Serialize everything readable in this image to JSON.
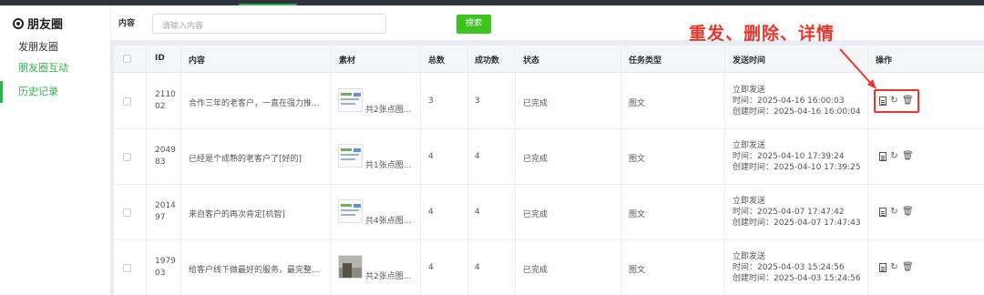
{
  "sidebar": {
    "title": "朋友圈",
    "items": [
      {
        "label": "发朋友圈"
      },
      {
        "label": "朋友圈互动"
      },
      {
        "label": "历史记录"
      }
    ]
  },
  "filter": {
    "label": "内容",
    "placeholder": "请输入内容",
    "search_label": "搜索"
  },
  "annotation": "重发、删除、详情",
  "table": {
    "headers": [
      "ID",
      "内容",
      "素材",
      "总数",
      "成功数",
      "状态",
      "任务类型",
      "发送时间",
      "操作"
    ],
    "rows": [
      {
        "id_a": "2110",
        "id_b": "02",
        "content": "合作三年的老客户，一直在强力推...",
        "material": "共2张点图...",
        "total": "3",
        "success": "3",
        "status": "已完成",
        "type": "图文",
        "send": "立即发送",
        "time": "时间：2025-04-16 16:00:03",
        "created": "创建时间：2025-04-16 16:00:04"
      },
      {
        "id_a": "2049",
        "id_b": "83",
        "content": "已经是个成熟的老客户了[好的]",
        "material": "共1张点图...",
        "total": "4",
        "success": "4",
        "status": "已完成",
        "type": "图文",
        "send": "立即发送",
        "time": "时间：2025-04-10 17:39:24",
        "created": "创建时间：2025-04-10 17:39:25"
      },
      {
        "id_a": "2014",
        "id_b": "97",
        "content": "来自客户的再次肯定[机智]",
        "material": "共4张点图...",
        "total": "4",
        "success": "4",
        "status": "已完成",
        "type": "图文",
        "send": "立即发送",
        "time": "时间：2025-04-07 17:47:42",
        "created": "创建时间：2025-04-07 17:47:43"
      },
      {
        "id_a": "1979",
        "id_b": "03",
        "content": "给客户线下做最好的服务，最完整...",
        "material": "共2张点图...",
        "total": "4",
        "success": "4",
        "status": "已完成",
        "type": "图文",
        "send": "立即发送",
        "time": "时间：2025-04-03 15:24:56",
        "created": "创建时间：2025-04-03 15:24:56"
      }
    ]
  },
  "colors": {
    "accent": "#3cc31e",
    "annotation": "#e8362b"
  }
}
